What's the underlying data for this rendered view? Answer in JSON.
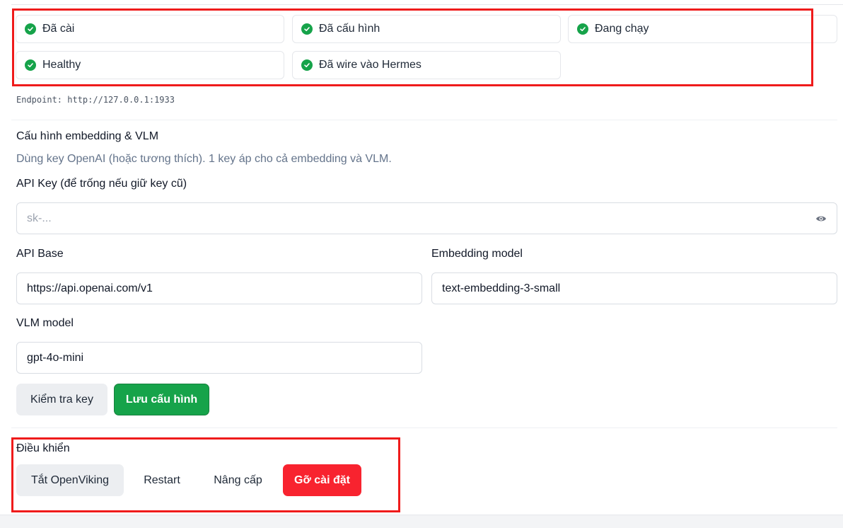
{
  "status_chips": [
    {
      "label": "Đã cài"
    },
    {
      "label": "Đã cấu hình"
    },
    {
      "label": "Đang chạy"
    },
    {
      "label": "Healthy"
    },
    {
      "label": "Đã wire vào Hermes"
    }
  ],
  "endpoint": "Endpoint: http://127.0.0.1:1933",
  "config": {
    "title": "Cấu hình embedding & VLM",
    "description": "Dùng key OpenAI (hoặc tương thích). 1 key áp cho cả embedding và VLM.",
    "api_key_label": "API Key (để trống nếu giữ key cũ)",
    "api_key_placeholder": "sk-...",
    "api_base_label": "API Base",
    "api_base_value": "https://api.openai.com/v1",
    "embedding_label": "Embedding model",
    "embedding_value": "text-embedding-3-small",
    "vlm_label": "VLM model",
    "vlm_value": "gpt-4o-mini",
    "test_key_button": "Kiểm tra key",
    "save_button": "Lưu cấu hình"
  },
  "controls": {
    "title": "Điều khiển",
    "stop_button": "Tắt OpenViking",
    "restart_button": "Restart",
    "upgrade_button": "Nâng cấp",
    "uninstall_button": "Gỡ cài đặt"
  },
  "colors": {
    "success": "#16a34a",
    "danger": "#f8232f",
    "highlight": "#ef1b1b"
  }
}
